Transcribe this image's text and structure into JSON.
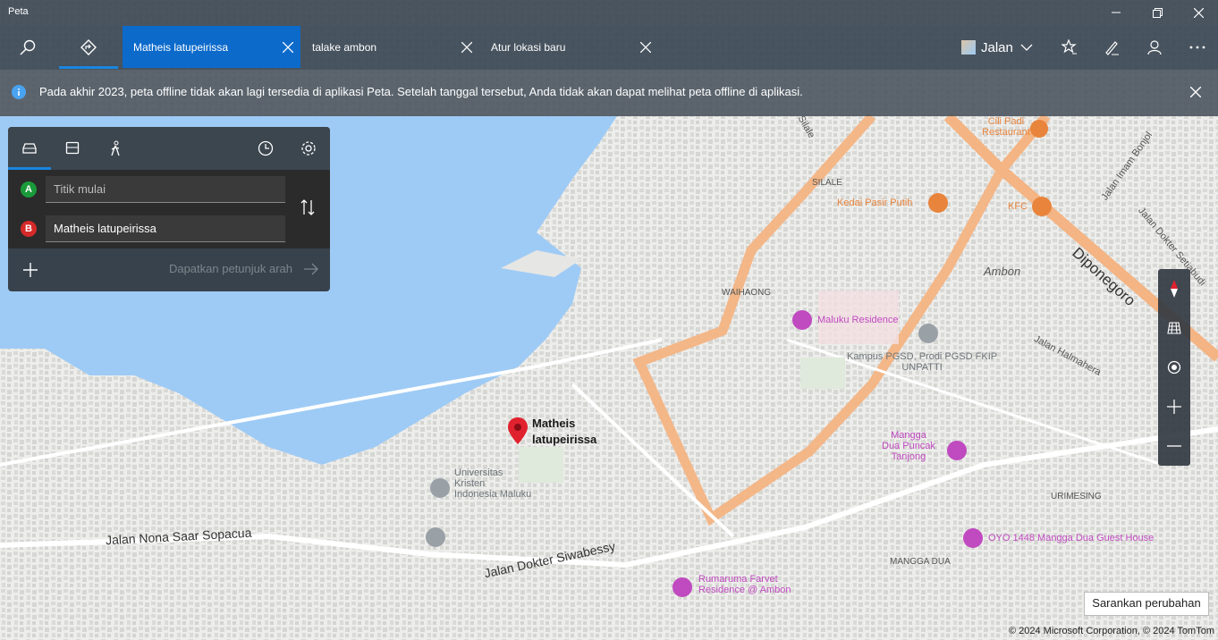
{
  "app": {
    "title": "Peta"
  },
  "tabs": [
    {
      "label": "Matheis latupeirissa",
      "active": true
    },
    {
      "label": "talake ambon",
      "active": false
    },
    {
      "label": "Atur lokasi baru",
      "active": false
    }
  ],
  "toolbar": {
    "map_style_label": "Jalan"
  },
  "banner": {
    "text": "Pada akhir 2023, peta offline tidak akan lagi tersedia di aplikasi Peta. Setelah tanggal tersebut, Anda tidak akan dapat melihat peta offline di aplikasi."
  },
  "directions": {
    "start_badge": "A",
    "end_badge": "B",
    "start_placeholder": "Titik mulai",
    "end_value": "Matheis latupeirissa",
    "get_directions_label": "Dapatkan petunjuk arah"
  },
  "map": {
    "selected_pin_label_line1": "Matheis",
    "selected_pin_label_line2": "latupeirissa",
    "labels": {
      "silale_road": "Silale",
      "silale_area": "SILALE",
      "waihaong": "WAIHAONG",
      "ambon": "Ambon",
      "jalan_imam_bonjol": "Jalan Imam Bonjol",
      "jalan_dokter_setiabudi": "Jalan Dokter Setiabudi",
      "diponegoro": "Diponegoro",
      "jalan_halmahera": "Jalan Halmahera",
      "jalan_nona_saar_sopacua": "Jalan Nona Saar Sopacua",
      "jalan_dokter_siwabessy": "Jalan Dokter Siwabessy",
      "urimesing": "URIMESING",
      "mangga_dua": "MANGGA DUA"
    },
    "pois": {
      "cili_padi_1": "Cili Padi",
      "cili_padi_2": "Restaurant",
      "kedai_pasir_putih": "Kedai Pasir Putih",
      "kfc": "KFC",
      "maluku_residence": "Maluku Residence",
      "kampus_1": "Kampus PGSD, Prodi PGSD FKIP",
      "kampus_2": "UNPATTI",
      "ukim_1": "Universitas",
      "ukim_2": "Kristen",
      "ukim_3": "Indonesia Maluku",
      "mangga_dua_puncak_1": "Mangga",
      "mangga_dua_puncak_2": "Dua Puncak",
      "mangga_dua_puncak_3": "Tanjong",
      "oyo": "OYO 1448 Mangga Dua Guest House",
      "rumaruma_1": "Rumaruma Farvet",
      "rumaruma_2": "Residence @ Ambon"
    }
  },
  "suggest_label": "Sarankan perubahan",
  "copyright": "© 2024 Microsoft Corporation, © 2024 TomTom",
  "colors": {
    "accent": "#0c6acb",
    "water": "#9ecbf5",
    "route": "#f4b483",
    "poi_pink": "#c04ac0",
    "poi_orange": "#e8843c"
  }
}
